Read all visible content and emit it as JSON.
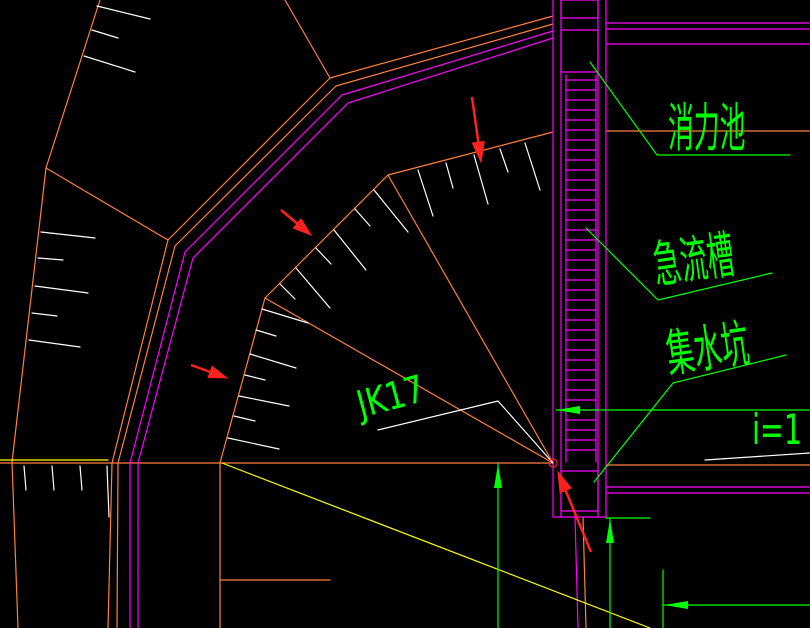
{
  "labels": {
    "stilling_basin": "消力池",
    "chute": "急流槽",
    "sump": "集水坑",
    "section_id": "JK17",
    "slope_ratio": "i=1"
  },
  "colors": {
    "background": "#000000",
    "orange": "#ff8040",
    "magenta": "#ff00ff",
    "green": "#00ff00",
    "yellow": "#ffff00",
    "white": "#ffffff",
    "red": "#ff2020"
  }
}
